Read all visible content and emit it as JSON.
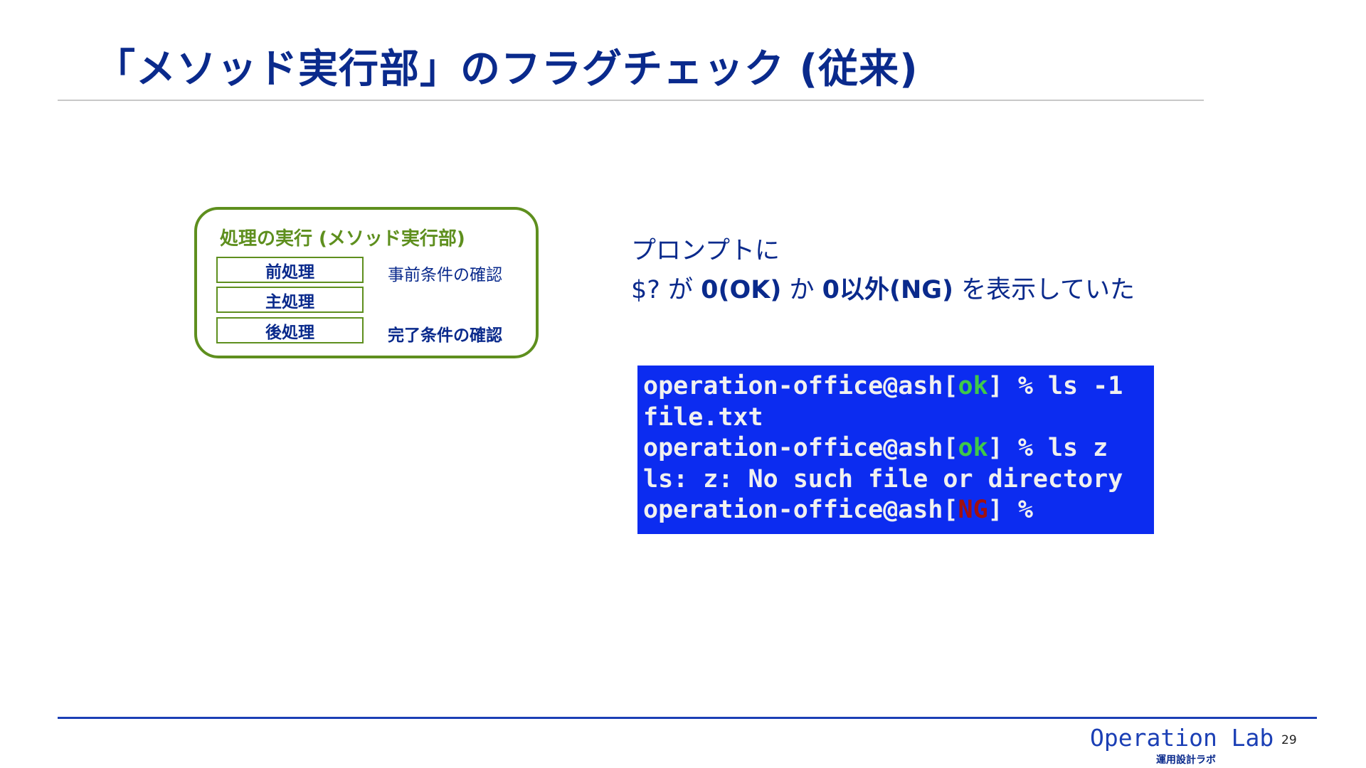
{
  "slide": {
    "title": "「メソッド実行部」のフラグチェック (従来)",
    "page_number": "29"
  },
  "diagram": {
    "title": "処理の実行 (メソッド実行部)",
    "steps": [
      {
        "label": "前処理",
        "condition": "事前条件の確認"
      },
      {
        "label": "主処理",
        "condition": ""
      },
      {
        "label": "後処理",
        "condition": "完了条件の確認"
      }
    ]
  },
  "explanation": {
    "line1": "プロンプトに",
    "line2_prefix": "$? が ",
    "line2_ok": "0(OK)",
    "line2_mid": " か ",
    "line2_ng": "0以外(NG)",
    "line2_suffix": " を表示していた"
  },
  "terminal": {
    "prompt_prefix": "operation-office@ash",
    "ok_text": "ok",
    "ng_text": "NG",
    "lines": {
      "cmd1": " % ls -1",
      "out1": "file.txt",
      "cmd2": " % ls z",
      "out2": "ls: z: No such file or directory",
      "cmd3": " %"
    },
    "colors": {
      "background": "#0c2cf0",
      "ok": "#3ec84a",
      "ng": "#a01010"
    }
  },
  "footer": {
    "brand": "Operation Lab",
    "brand_sub": "運用設計ラボ"
  }
}
